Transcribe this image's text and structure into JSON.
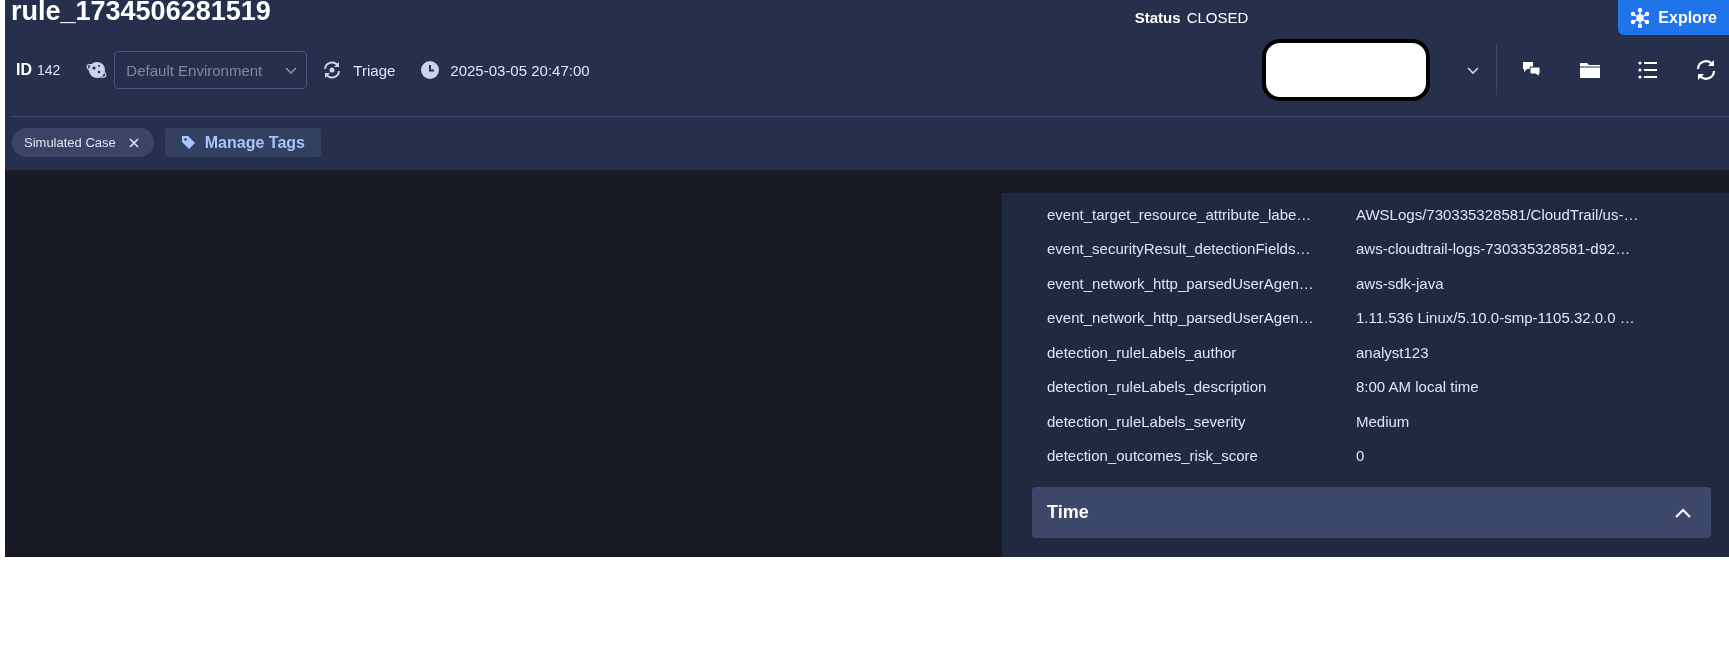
{
  "title": "rule_1734506281519",
  "status": {
    "label": "Status",
    "value": "CLOSED"
  },
  "explore_button": "Explore",
  "id": {
    "label": "ID",
    "value": "142"
  },
  "environment_select": {
    "placeholder": "Default Environment"
  },
  "stage": "Triage",
  "timestamp": "2025-03-05 20:47:00",
  "tags": [
    {
      "label": "Simulated Case"
    }
  ],
  "manage_tags_button": "Manage Tags",
  "fields": [
    {
      "key": "event_target_resource_attribute_labe…",
      "value": "AWSLogs/730335328581/CloudTrail/us-…"
    },
    {
      "key": "event_securityResult_detectionFields…",
      "value": "aws-cloudtrail-logs-730335328581-d92…"
    },
    {
      "key": "event_network_http_parsedUserAgen…",
      "value": "aws-sdk-java"
    },
    {
      "key": "event_network_http_parsedUserAgen…",
      "value": "1.11.536 Linux/5.10.0-smp-1105.32.0.0 …"
    },
    {
      "key": "detection_ruleLabels_author",
      "value": "analyst123"
    },
    {
      "key": "detection_ruleLabels_description",
      "value": "8:00 AM local time"
    },
    {
      "key": "detection_ruleLabels_severity",
      "value": "Medium"
    },
    {
      "key": "detection_outcomes_risk_score",
      "value": "0"
    }
  ],
  "sections": [
    {
      "title": "Time",
      "expanded": true
    }
  ]
}
